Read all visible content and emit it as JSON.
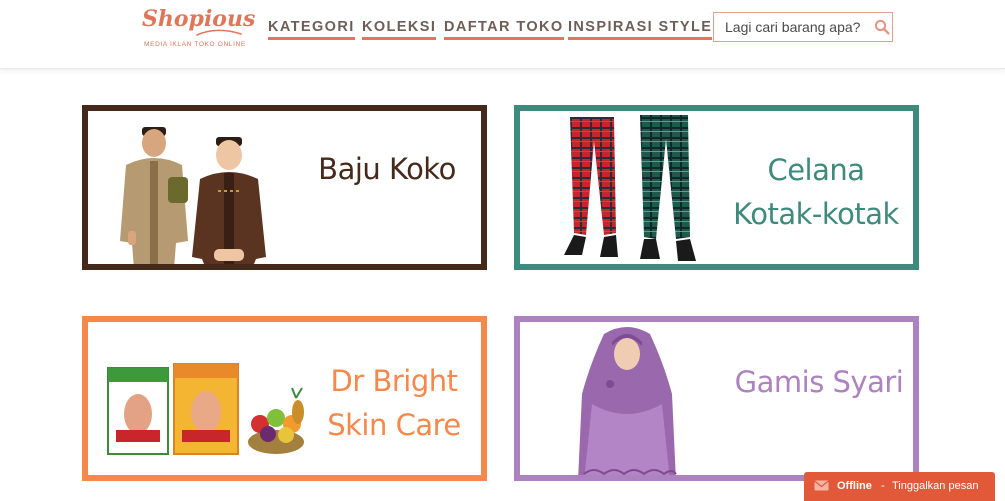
{
  "logo": {
    "name": "Shopious",
    "tagline": "MEDIA IKLAN TOKO ONLINE"
  },
  "nav": {
    "items": [
      {
        "label": "KATEGORI"
      },
      {
        "label": "KOLEKSI"
      },
      {
        "label": "DAFTAR TOKO"
      },
      {
        "label": "INSPIRASI STYLE"
      }
    ]
  },
  "search": {
    "placeholder": "Lagi cari barang apa?",
    "icon": "search-icon"
  },
  "cards": [
    {
      "title_lines": [
        "Baju Koko"
      ],
      "color": "#45291b",
      "image": "men-in-koko-shirts"
    },
    {
      "title_lines": [
        "Celana",
        "Kotak-kotak"
      ],
      "color": "#3e8a7c",
      "image": "plaid-trousers"
    },
    {
      "title_lines": [
        "Dr Bright",
        "Skin Care"
      ],
      "color": "#f5884a",
      "image": "skin-care-boxes-and-fruit"
    },
    {
      "title_lines": [
        "Gamis Syari"
      ],
      "color": "#ad82be",
      "image": "woman-in-purple-gamis"
    }
  ],
  "chat": {
    "status": "Offline",
    "separator": "-",
    "message": "Tinggalkan pesan",
    "icon": "envelope-icon",
    "color": "#e2593a"
  },
  "colors": {
    "accent": "#e0755a",
    "nav_text": "#6e5e57"
  }
}
